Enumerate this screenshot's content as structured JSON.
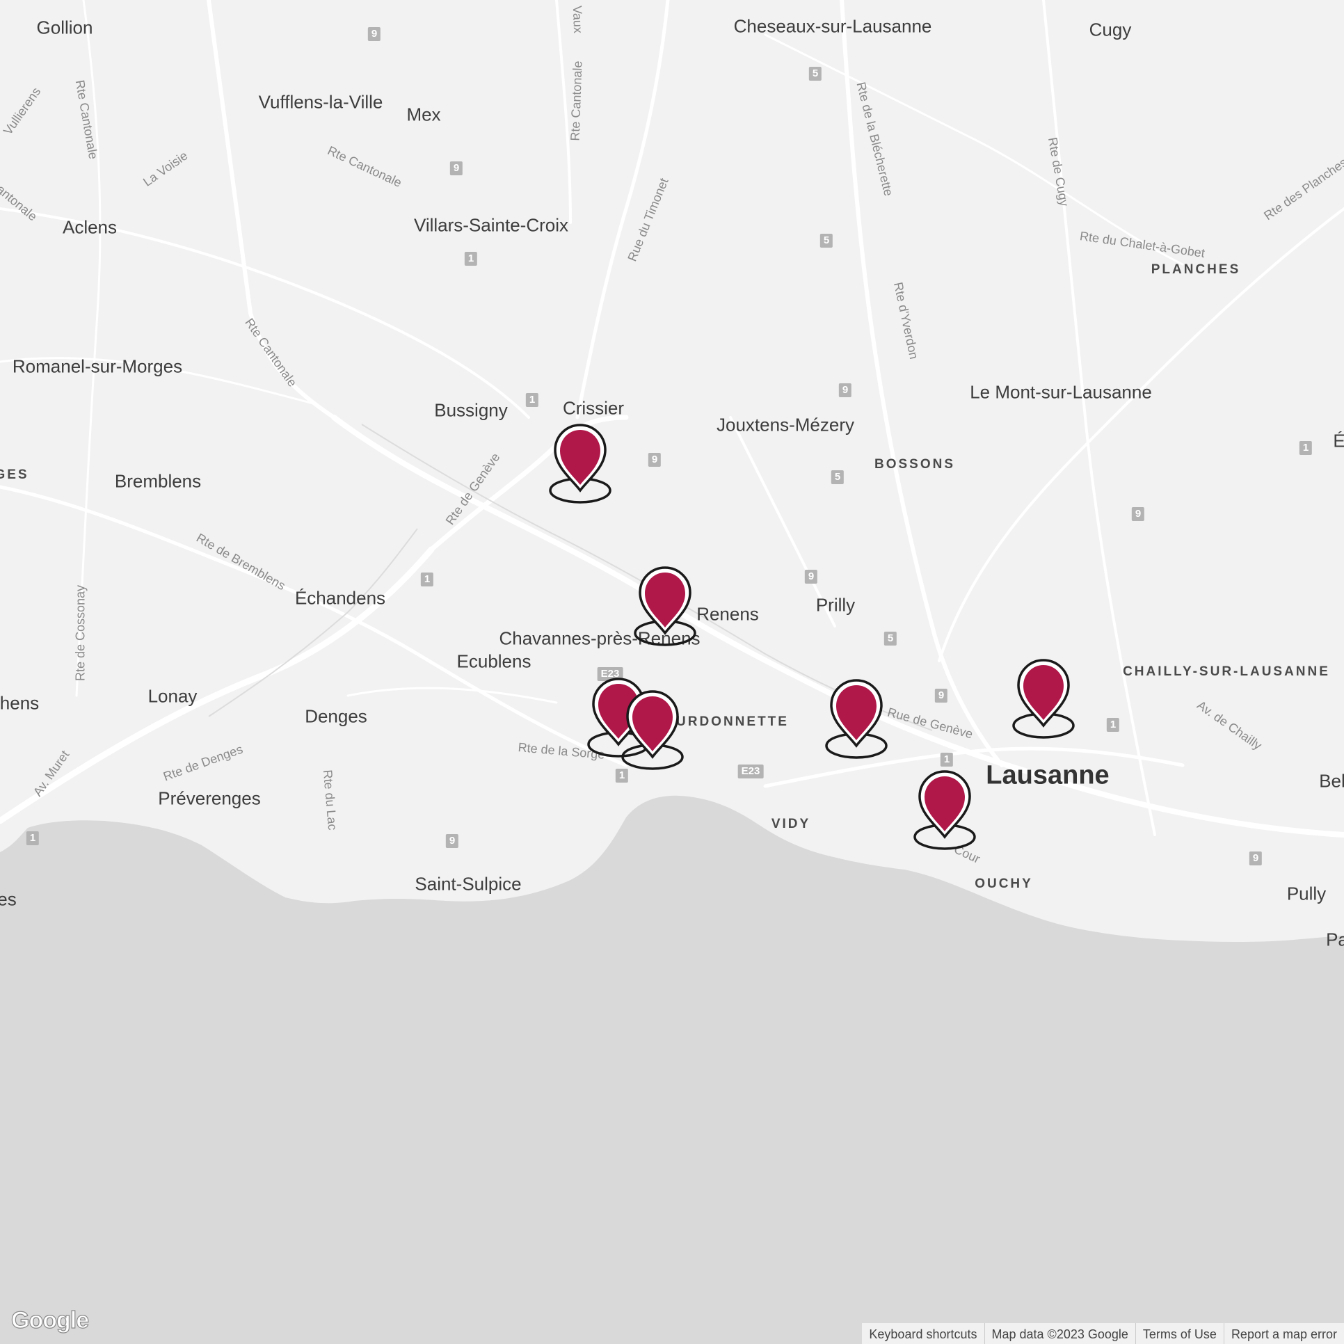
{
  "map": {
    "colors": {
      "land": "#f2f2f2",
      "water": "#d9d9d9",
      "road": "#ffffff",
      "marker_fill": "#b0184a",
      "marker_stroke": "#1a1a1a"
    },
    "places": [
      {
        "id": "gollion",
        "text": "Gollion"
      },
      {
        "id": "cheseaux",
        "text": "Cheseaux-sur-Lausanne"
      },
      {
        "id": "cugy",
        "text": "Cugy"
      },
      {
        "id": "vufflens",
        "text": "Vufflens-la-Ville"
      },
      {
        "id": "mex",
        "text": "Mex"
      },
      {
        "id": "aclens",
        "text": "Aclens"
      },
      {
        "id": "villars",
        "text": "Villars-Sainte-Croix"
      },
      {
        "id": "romanel",
        "text": "Romanel-sur-Morges"
      },
      {
        "id": "bussigny",
        "text": "Bussigny"
      },
      {
        "id": "crissier",
        "text": "Crissier"
      },
      {
        "id": "jouxtens",
        "text": "Jouxtens-Mézery"
      },
      {
        "id": "mont",
        "text": "Le Mont-sur-Lausanne"
      },
      {
        "id": "bremblens",
        "text": "Bremblens"
      },
      {
        "id": "echandens",
        "text": "Échandens"
      },
      {
        "id": "renens",
        "text": "Renens"
      },
      {
        "id": "prilly",
        "text": "Prilly"
      },
      {
        "id": "chavannes",
        "text": "Chavannes-près-Renens"
      },
      {
        "id": "ecublens",
        "text": "Ecublens"
      },
      {
        "id": "lonay",
        "text": "Lonay"
      },
      {
        "id": "denges",
        "text": "Denges"
      },
      {
        "id": "preverenges",
        "text": "Préverenges"
      },
      {
        "id": "saintsulpice",
        "text": "Saint-Sulpice"
      },
      {
        "id": "pully",
        "text": "Pully"
      },
      {
        "id": "ges",
        "text": "GES"
      },
      {
        "id": "hens",
        "text": "hens"
      },
      {
        "id": "es",
        "text": "es"
      },
      {
        "id": "bel",
        "text": "Bel"
      },
      {
        "id": "pa",
        "text": "Pa"
      },
      {
        "id": "e_edge",
        "text": "É"
      }
    ],
    "city": {
      "text": "Lausanne"
    },
    "districts": [
      {
        "id": "planches",
        "text": "PLANCHES"
      },
      {
        "id": "bossons",
        "text": "BOSSONS"
      },
      {
        "id": "chailly",
        "text": "CHAILLY-SUR-LAUSANNE"
      },
      {
        "id": "bourdonnette",
        "text": "URDONNETTE"
      },
      {
        "id": "vidy",
        "text": "VIDY"
      },
      {
        "id": "ouchy",
        "text": "OUCHY"
      }
    ],
    "roads": [
      {
        "id": "r1",
        "text": "Rte Cantonale"
      },
      {
        "id": "r2",
        "text": "La Voisie"
      },
      {
        "id": "r3",
        "text": "Rte Cantonale"
      },
      {
        "id": "r4",
        "text": "Rte Cantonale"
      },
      {
        "id": "r5",
        "text": "Rte Cantonale"
      },
      {
        "id": "r6",
        "text": "Rue du Timonet"
      },
      {
        "id": "r7",
        "text": "Rte de la Blécherette"
      },
      {
        "id": "r8",
        "text": "Rte de Cugy"
      },
      {
        "id": "r9",
        "text": "Rte du Chalet-à-Gobet"
      },
      {
        "id": "r10",
        "text": "Rte des Planches"
      },
      {
        "id": "r11",
        "text": "Rte d'Yverdon"
      },
      {
        "id": "r12",
        "text": "Rte de Genève"
      },
      {
        "id": "r13",
        "text": "Rte de Bremblens"
      },
      {
        "id": "r14",
        "text": "Rte de Cossonay"
      },
      {
        "id": "r15",
        "text": "Rue de Genève"
      },
      {
        "id": "r16",
        "text": "Av. de Chailly"
      },
      {
        "id": "r17",
        "text": "Rte de la Sorge"
      },
      {
        "id": "r18",
        "text": "Rte de Denges"
      },
      {
        "id": "r19",
        "text": "Rte du Lac"
      },
      {
        "id": "r20",
        "text": "Av. Muret"
      },
      {
        "id": "r21",
        "text": "Vaux"
      },
      {
        "id": "r22",
        "text": "Vullierens"
      },
      {
        "id": "r23",
        "text": "antonale"
      },
      {
        "id": "r24",
        "text": "Cour"
      }
    ],
    "shields": [
      {
        "text": "9"
      },
      {
        "text": "5"
      },
      {
        "text": "9"
      },
      {
        "text": "1"
      },
      {
        "text": "5"
      },
      {
        "text": "1"
      },
      {
        "text": "9"
      },
      {
        "text": "9"
      },
      {
        "text": "5"
      },
      {
        "text": "1"
      },
      {
        "text": "9"
      },
      {
        "text": "1"
      },
      {
        "text": "9"
      },
      {
        "text": "5"
      },
      {
        "text": "9"
      },
      {
        "text": "1"
      },
      {
        "text": "1"
      },
      {
        "text": "E23"
      },
      {
        "text": "1"
      },
      {
        "text": "1"
      },
      {
        "text": "9"
      },
      {
        "text": "9"
      },
      {
        "text": "E23"
      }
    ],
    "markers_count": 7
  },
  "footer": {
    "logo": "Google",
    "keyboard": "Keyboard shortcuts",
    "mapdata": "Map data ©2023 Google",
    "terms": "Terms of Use",
    "report": "Report a map error"
  }
}
